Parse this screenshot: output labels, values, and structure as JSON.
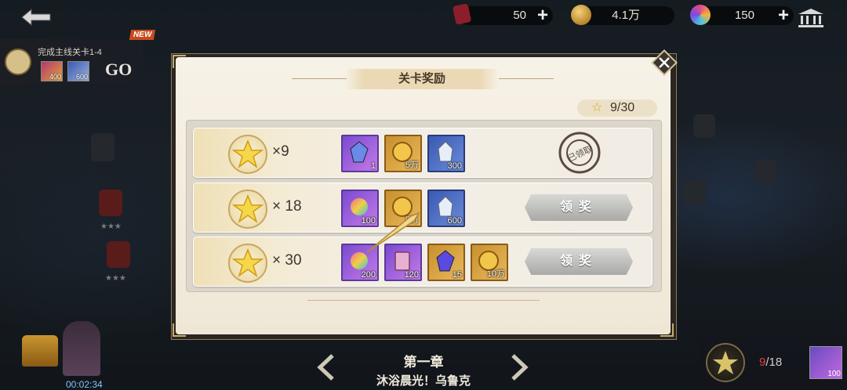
{
  "top_bar": {
    "ticket_value": "50",
    "gold_value": "4.1万",
    "gem_value": "150",
    "plus_label": "+"
  },
  "quest": {
    "text": "完成主线关卡1-4",
    "reward1": "400",
    "reward2": "600",
    "go_label": "GO",
    "new_badge": "NEW"
  },
  "modal": {
    "title": "关卡奖励",
    "star_progress": "9/30",
    "rows": [
      {
        "requirement": "×9",
        "items": [
          {
            "icon": "purple-crystal",
            "rarity": "purple",
            "count": "1"
          },
          {
            "icon": "gold-coin",
            "rarity": "gold",
            "count": "5万"
          },
          {
            "icon": "white-crystal",
            "rarity": "blue",
            "count": "300"
          }
        ],
        "status": "claimed",
        "stamp_text": "已领取",
        "stamp_ring": "REWARDS · RECEIVE"
      },
      {
        "requirement": "× 18",
        "items": [
          {
            "icon": "rainbow-gem",
            "rarity": "purple",
            "count": "100"
          },
          {
            "icon": "gold-coin",
            "rarity": "gold",
            "count": "5万"
          },
          {
            "icon": "white-crystal",
            "rarity": "blue",
            "count": "600"
          }
        ],
        "status": "claimable",
        "button_label": "领奖"
      },
      {
        "requirement": "× 30",
        "items": [
          {
            "icon": "rainbow-gem",
            "rarity": "purple",
            "count": "200"
          },
          {
            "icon": "card-pack",
            "rarity": "purple",
            "count": "120"
          },
          {
            "icon": "purple-crystal",
            "rarity": "gold",
            "count": "15"
          },
          {
            "icon": "gold-coin",
            "rarity": "gold",
            "count": "10万"
          }
        ],
        "status": "claimable",
        "button_label": "领奖"
      }
    ]
  },
  "chapter": {
    "number": "第一章",
    "name": "沐浴晨光！乌鲁克"
  },
  "timer": "00:02:34",
  "star_total": {
    "current": "9",
    "total": "/18",
    "reward_count": "100"
  },
  "colors": {
    "accent_gold": "#c8a660",
    "panel_bg": "#f4eee2",
    "claim_button": "#b9b9b6"
  }
}
